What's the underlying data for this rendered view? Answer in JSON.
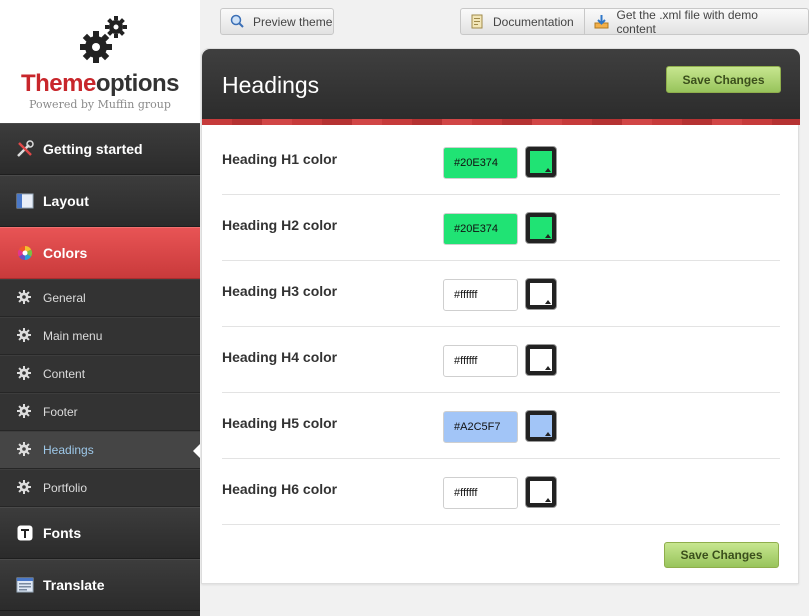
{
  "logo": {
    "title_part1": "Theme",
    "title_part2": "options",
    "subtitle": "Powered by Muffin group"
  },
  "toolbar": {
    "preview_label": "Preview theme",
    "documentation_label": "Documentation",
    "demo_label": "Get the .xml file with demo content"
  },
  "sidebar": {
    "items": [
      {
        "label": "Getting started"
      },
      {
        "label": "Layout"
      },
      {
        "label": "Colors"
      }
    ],
    "sub_items": [
      {
        "label": "General"
      },
      {
        "label": "Main menu"
      },
      {
        "label": "Content"
      },
      {
        "label": "Footer"
      },
      {
        "label": "Headings"
      },
      {
        "label": "Portfolio"
      }
    ],
    "bottom_items": [
      {
        "label": "Fonts"
      },
      {
        "label": "Translate"
      }
    ]
  },
  "panel": {
    "title": "Headings",
    "save_label": "Save Changes",
    "rows": [
      {
        "label": "Heading H1 color",
        "value": "#20E374",
        "color": "#20E374"
      },
      {
        "label": "Heading H2 color",
        "value": "#20E374",
        "color": "#20E374"
      },
      {
        "label": "Heading H3 color",
        "value": "#ffffff",
        "color": "#ffffff"
      },
      {
        "label": "Heading H4 color",
        "value": "#ffffff",
        "color": "#ffffff"
      },
      {
        "label": "Heading H5 color",
        "value": "#A2C5F7",
        "color": "#A2C5F7"
      },
      {
        "label": "Heading H6 color",
        "value": "#ffffff",
        "color": "#ffffff"
      }
    ]
  },
  "colors": {
    "accent_red": "#d9494a",
    "nav_dark": "#2e2e2e",
    "save_green": "#a8d26a",
    "active_sub_text": "#9ec9ea"
  }
}
